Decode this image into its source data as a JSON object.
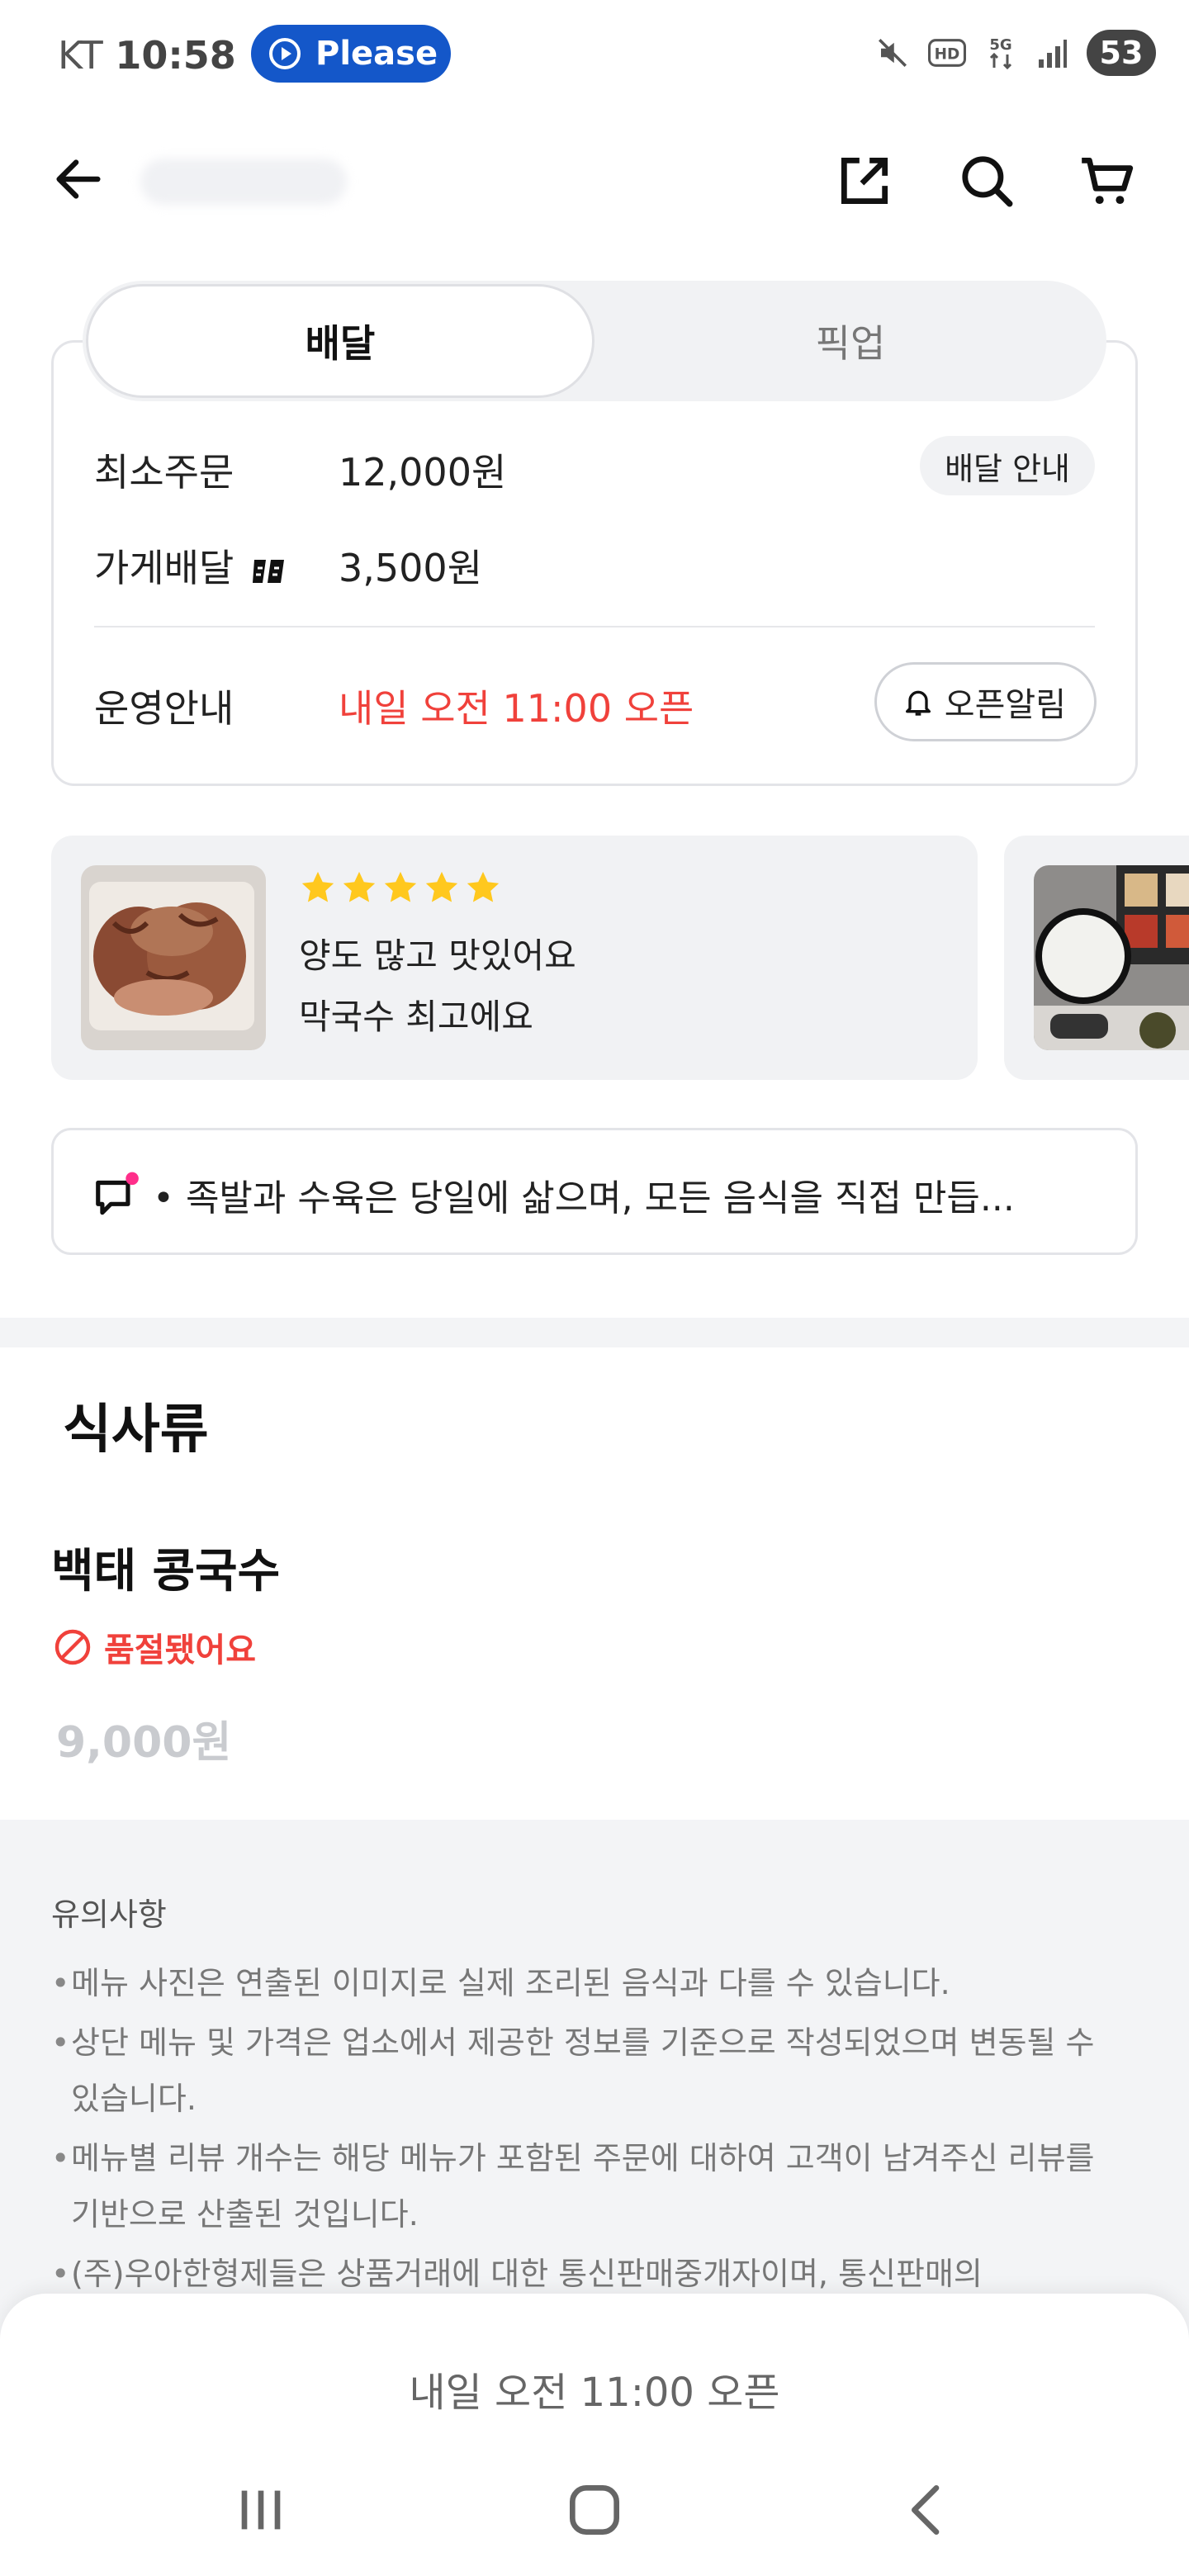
{
  "status_bar": {
    "carrier": "KT",
    "time": "10:58",
    "pill_label": "Please",
    "battery": "53"
  },
  "tabs": [
    {
      "label": "배달",
      "active": true
    },
    {
      "label": "픽업",
      "active": false
    }
  ],
  "info": {
    "min_order_label": "최소주문",
    "min_order_value": "12,000원",
    "delivery_info_chip": "배달 안내",
    "store_delivery_label": "가게배달",
    "store_delivery_value": "3,500원",
    "operation_label": "운영안내",
    "operation_value": "내일 오전 11:00 오픈",
    "open_alarm_chip": "오픈알림"
  },
  "review": {
    "rating": 5,
    "line1": "양도 많고 맛있어요",
    "line2": "막국수 최고에요"
  },
  "notice": {
    "text": "• 족발과 수육은 당일에 삶으며, 모든 음식을 직접 만듭..."
  },
  "section": {
    "title": "식사류"
  },
  "menu_item": {
    "name": "백태 콩국수",
    "status": "품절됐어요",
    "price": "9,000원"
  },
  "disclaimer": {
    "title": "유의사항",
    "items": [
      "메뉴 사진은 연출된 이미지로 실제 조리된 음식과 다를 수 있습니다.",
      "상단 메뉴 및 가격은 업소에서 제공한 정보를 기준으로 작성되었으며 변동될 수 있습니다.",
      "메뉴별 리뷰 개수는 해당 메뉴가 포함된 주문에 대하여 고객이 남겨주신 리뷰를 기반으로 산출된 것입니다.",
      "(주)우아한형제들은 상품거래에 대한 통신판매중개자이며, 통신판매의"
    ]
  },
  "bottom": {
    "open_label": "내일 오전 11:00 오픈"
  },
  "colors": {
    "accent_red": "#f0413b",
    "pill_blue": "#1457c9",
    "star_yellow": "#ffc81e"
  }
}
